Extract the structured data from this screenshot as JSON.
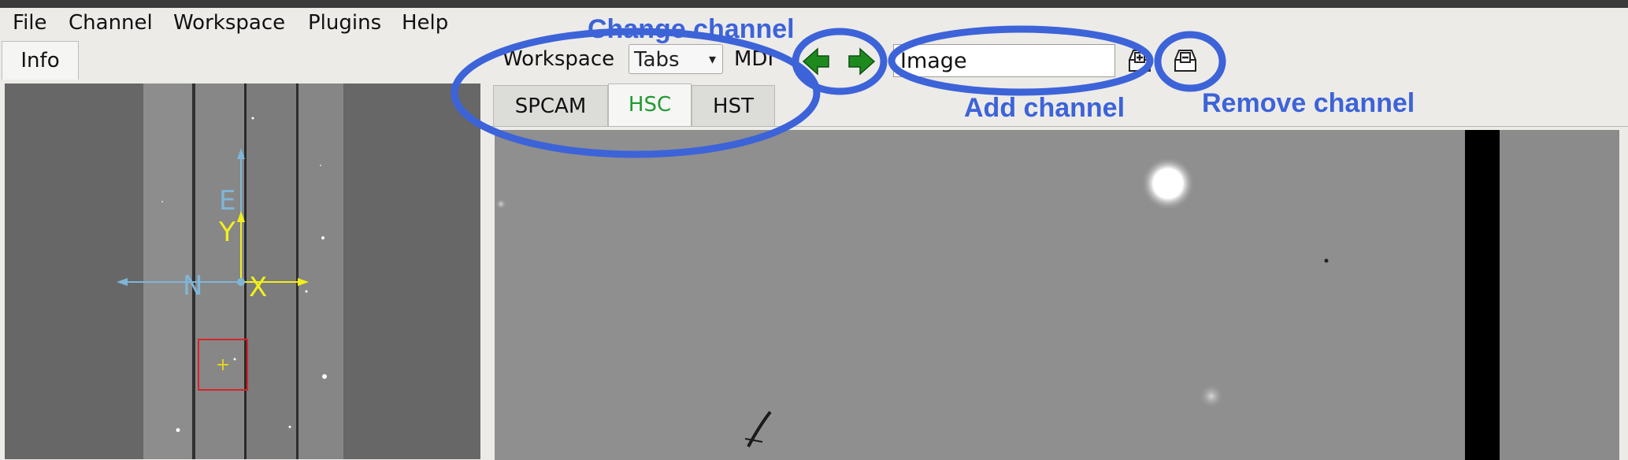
{
  "menubar": {
    "items": [
      "File",
      "Channel",
      "Workspace",
      "Plugins",
      "Help"
    ]
  },
  "left_panel": {
    "tab_label": "Info",
    "compass": {
      "east": "E",
      "north": "N",
      "x_axis": "X",
      "y_axis": "Y"
    }
  },
  "toolbar": {
    "workspace_label": "Workspace",
    "workspace_mode": "Tabs",
    "mdi_label": "MDI",
    "channel_name": "Image"
  },
  "channel_tabs": [
    {
      "label": "SPCAM",
      "active": false
    },
    {
      "label": "HSC",
      "active": true
    },
    {
      "label": "HST",
      "active": false
    }
  ],
  "annotations": {
    "change_channel": "Change channel",
    "add_channel": "Add channel",
    "remove_channel": "Remove channel"
  },
  "icons": {
    "prev_channel": "left-arrow-icon",
    "next_channel": "right-arrow-icon",
    "add_channel": "add-channel-icon",
    "remove_channel": "remove-channel-icon"
  },
  "colors": {
    "annotation": "#3d63d8",
    "active_tab_text": "#1f9a32",
    "arrow_green": "#1e8a1e",
    "compass_blue": "#7fb6d8",
    "compass_yellow": "#f2ef1c",
    "box_red": "#d8242a"
  }
}
